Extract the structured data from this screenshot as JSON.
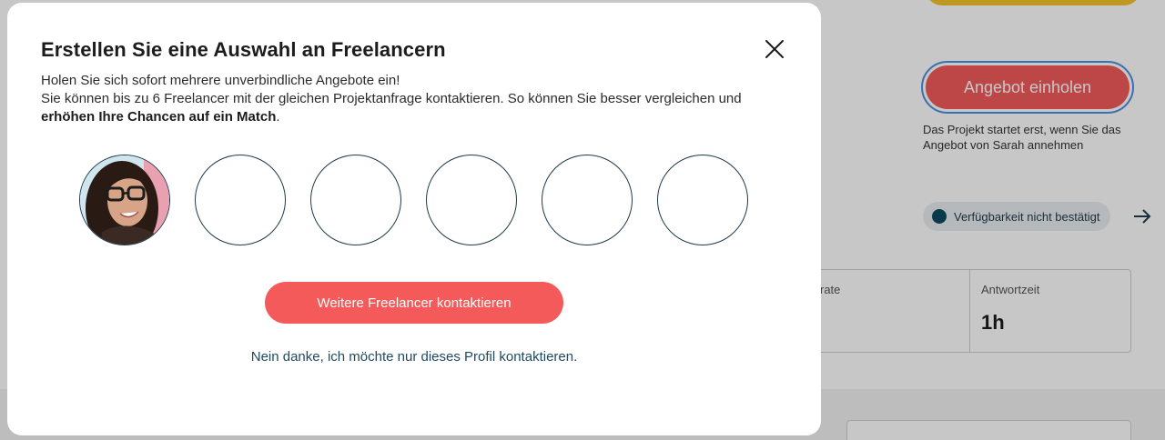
{
  "background": {
    "cta_label": "Angebot einholen",
    "note": "Das Projekt startet erst, wenn Sie das Angebot von Sarah annehmen",
    "availability_label": "Verfügbarkeit nicht bestätigt",
    "stats": [
      {
        "label": "rate",
        "value": ""
      },
      {
        "label": "Antwortzeit",
        "value": "1h"
      }
    ]
  },
  "modal": {
    "title": "Erstellen Sie eine Auswahl an Freelancern",
    "intro_line1": "Holen Sie sich sofort mehrere unverbindliche Angebote ein!",
    "intro_line2": "Sie können bis zu 6 Freelancer mit der gleichen Projektanfrage kontaktieren. So können Sie besser vergleichen und ",
    "intro_bold": "erhöhen Ihre Chancen auf ein Match",
    "intro_end": ".",
    "slots": [
      {
        "filled": true,
        "type": "avatar"
      },
      {
        "filled": false
      },
      {
        "filled": false
      },
      {
        "filled": false
      },
      {
        "filled": false
      },
      {
        "filled": false
      }
    ],
    "primary_button": "Weitere Freelancer kontaktieren",
    "secondary_link": "Nein danke, ich möchte nur dieses Profil kontaktieren.",
    "close_icon": "close-icon"
  },
  "colors": {
    "accent": "#f55a5a",
    "ring": "#1f3b4a",
    "link": "#1f4a60",
    "availability_dot": "#0e4b5e",
    "top_button": "#f5c32c"
  }
}
